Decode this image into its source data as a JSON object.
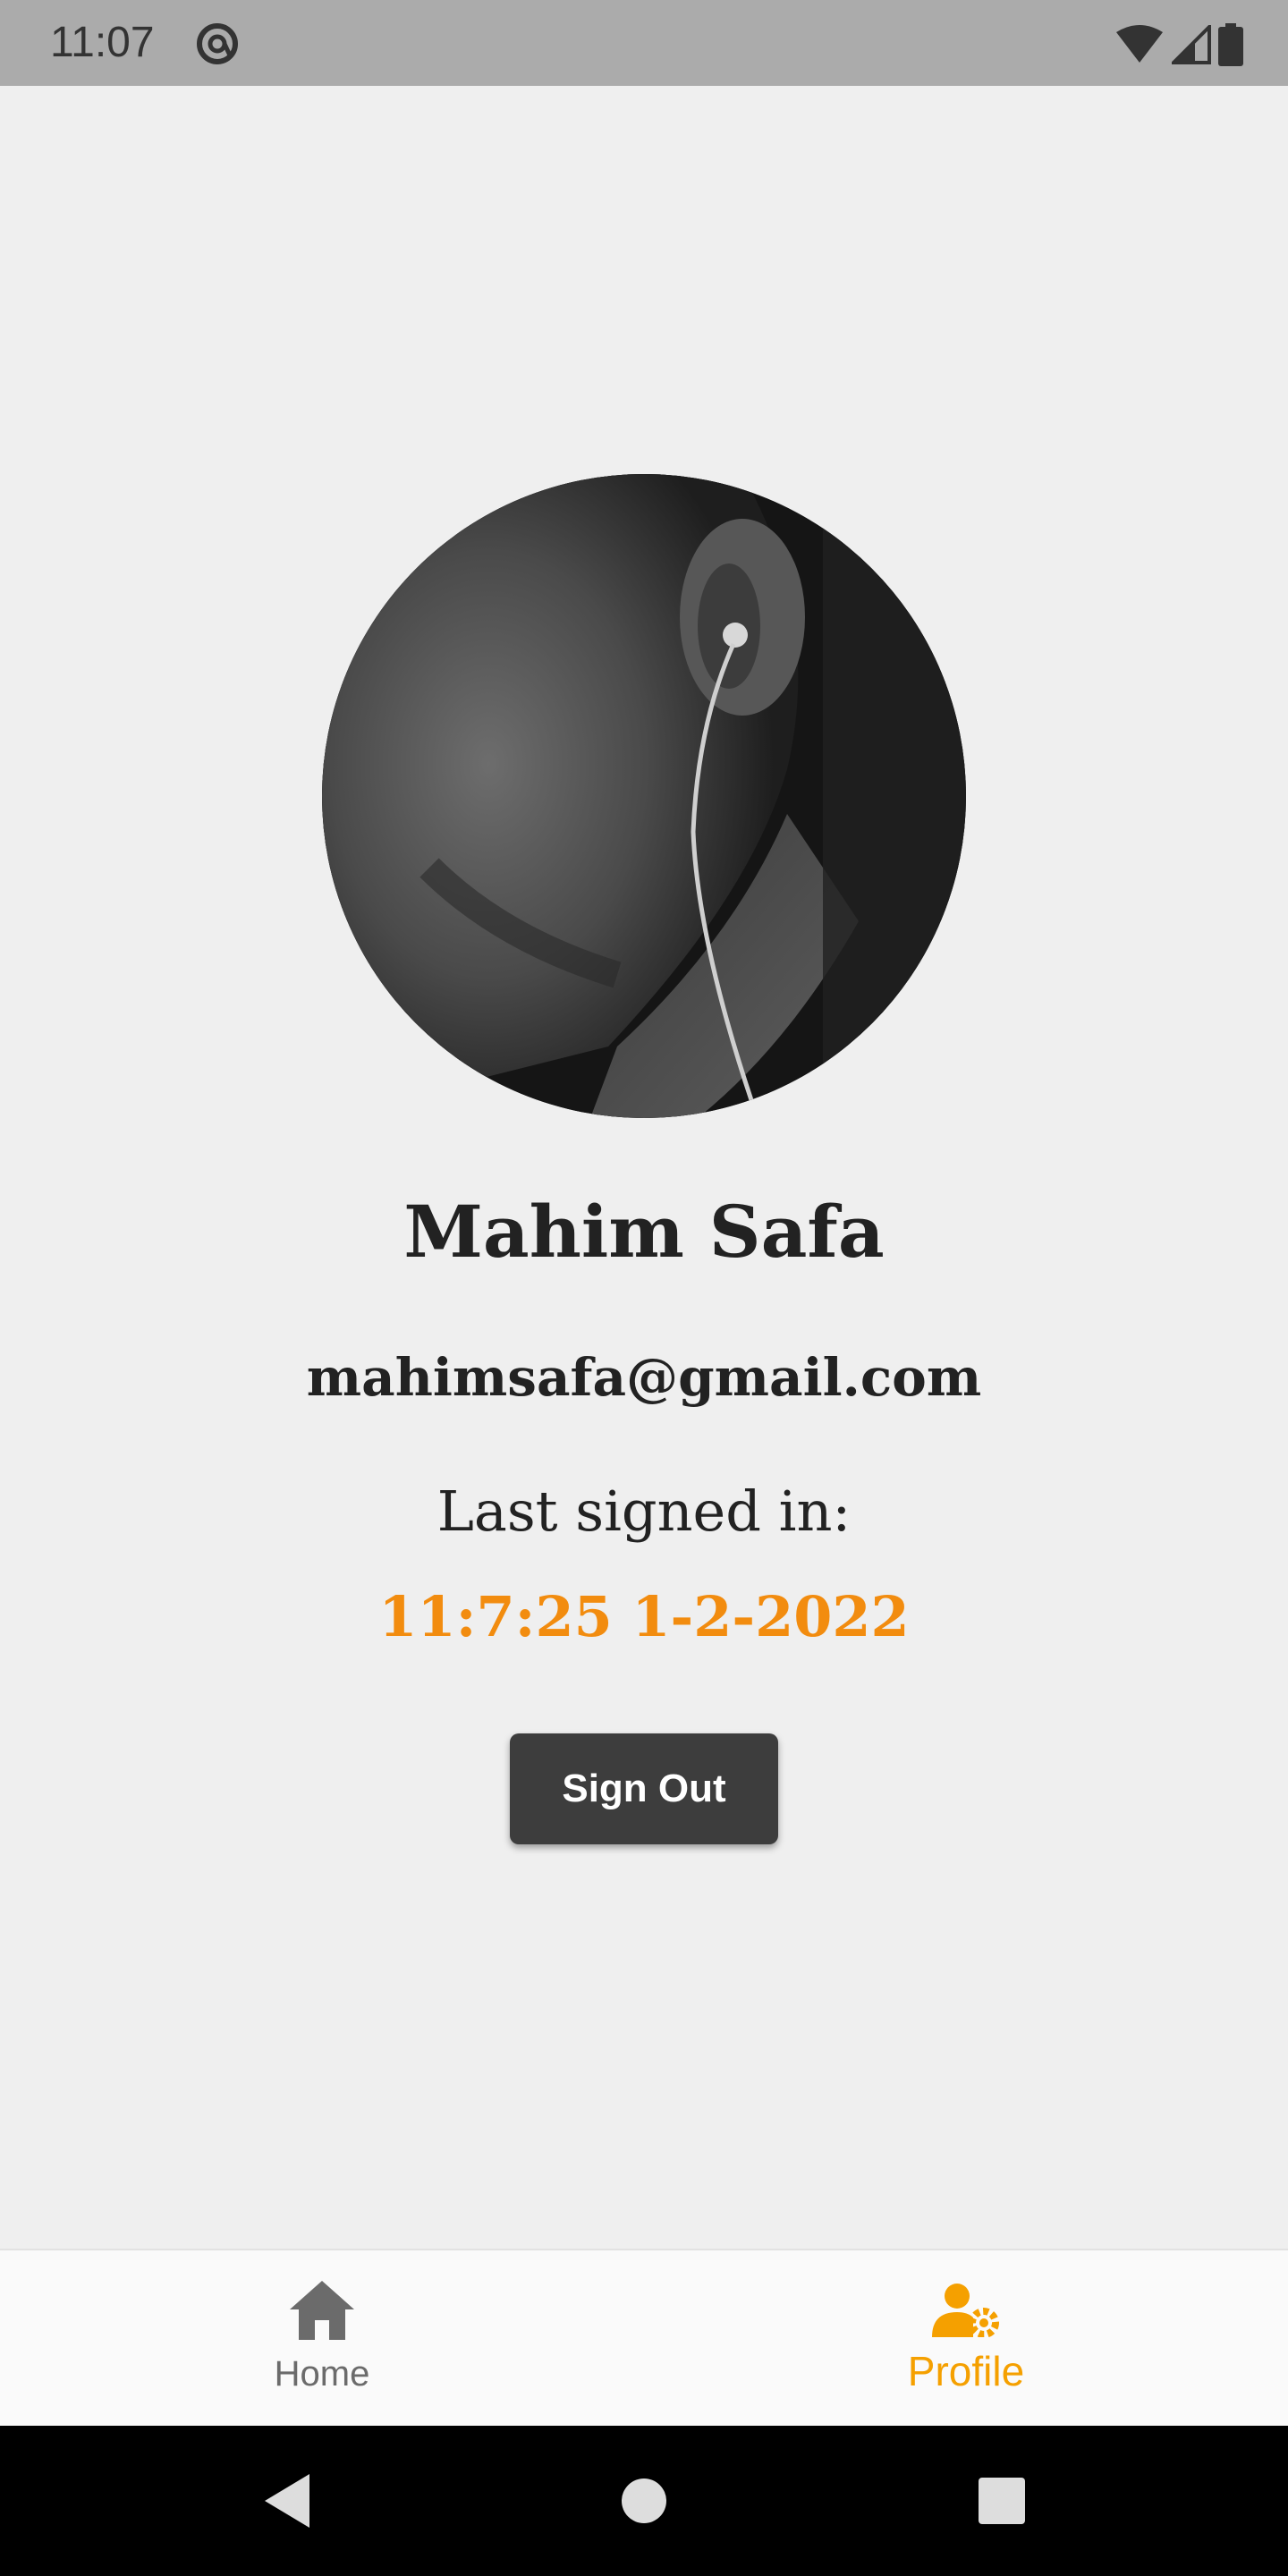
{
  "status_bar": {
    "time": "11:07",
    "icons": [
      "at-sign-icon",
      "wifi-icon",
      "cell-signal-icon",
      "battery-icon"
    ]
  },
  "profile": {
    "name": "Mahim Safa",
    "email": "mahimsafa@gmail.com",
    "last_signed_label": "Last signed in:",
    "last_signed_value": "11:7:25 1-2-2022",
    "signout_label": "Sign Out"
  },
  "bottom_nav": {
    "items": [
      {
        "label": "Home",
        "icon": "home-icon",
        "active": false
      },
      {
        "label": "Profile",
        "icon": "user-gear-icon",
        "active": true
      }
    ]
  },
  "system_nav": {
    "buttons": [
      "back-icon",
      "home-circle-icon",
      "recents-icon"
    ]
  },
  "colors": {
    "accent": "#f5a000",
    "timestamp": "#f28c0f",
    "button": "#3d3d3d",
    "background": "#efefef",
    "status_bar": "#ababab"
  }
}
